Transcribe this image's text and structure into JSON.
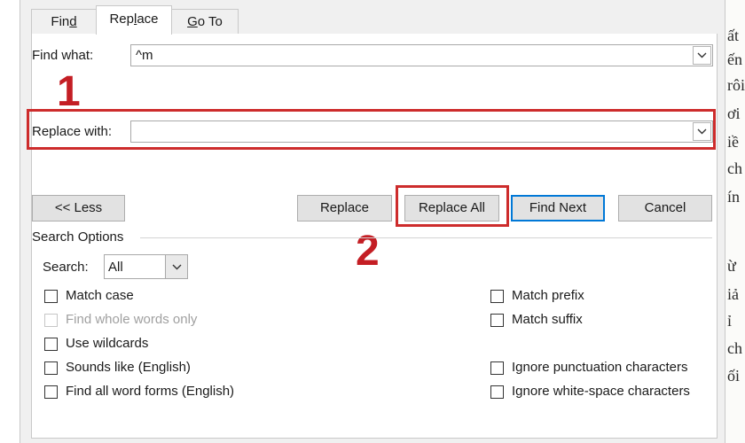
{
  "tabs": [
    {
      "label": "Find",
      "hotkey_index": 3
    },
    {
      "label": "Replace",
      "hotkey_index": 3
    },
    {
      "label": "Go To",
      "hotkey_index": 0
    }
  ],
  "find": {
    "label": "Find what:",
    "value": "^m"
  },
  "replace": {
    "label": "Replace with:",
    "value": ""
  },
  "annotations": {
    "step1": "1",
    "step2": "2",
    "highlight_color": "#cd2c2c"
  },
  "buttons": {
    "less": "<< Less",
    "replace": "Replace",
    "replace_all": "Replace All",
    "find_next": "Find Next",
    "cancel": "Cancel"
  },
  "search_options": {
    "heading": "Search Options",
    "search_label": "Search:",
    "search_value": "All"
  },
  "options_left": [
    {
      "label": "Match case",
      "checked": false,
      "disabled": false
    },
    {
      "label": "Find whole words only",
      "checked": false,
      "disabled": true
    },
    {
      "label": "Use wildcards",
      "checked": false,
      "disabled": false
    },
    {
      "label": "Sounds like (English)",
      "checked": false,
      "disabled": false
    },
    {
      "label": "Find all word forms (English)",
      "checked": false,
      "disabled": false
    }
  ],
  "options_right": [
    {
      "label": "Match prefix",
      "checked": false
    },
    {
      "label": "Match suffix",
      "checked": false
    },
    {
      "label": "Ignore punctuation characters",
      "checked": false
    },
    {
      "label": "Ignore white-space characters",
      "checked": false
    }
  ],
  "background_doc": [
    "ất",
    "ến",
    "rôi",
    "ơi",
    "iề",
    "ch",
    "ín",
    "ừ",
    "iả",
    "ỉ",
    "ch",
    "ối"
  ],
  "colors": {
    "accent": "#0078d7",
    "annotation": "#c41e24"
  }
}
